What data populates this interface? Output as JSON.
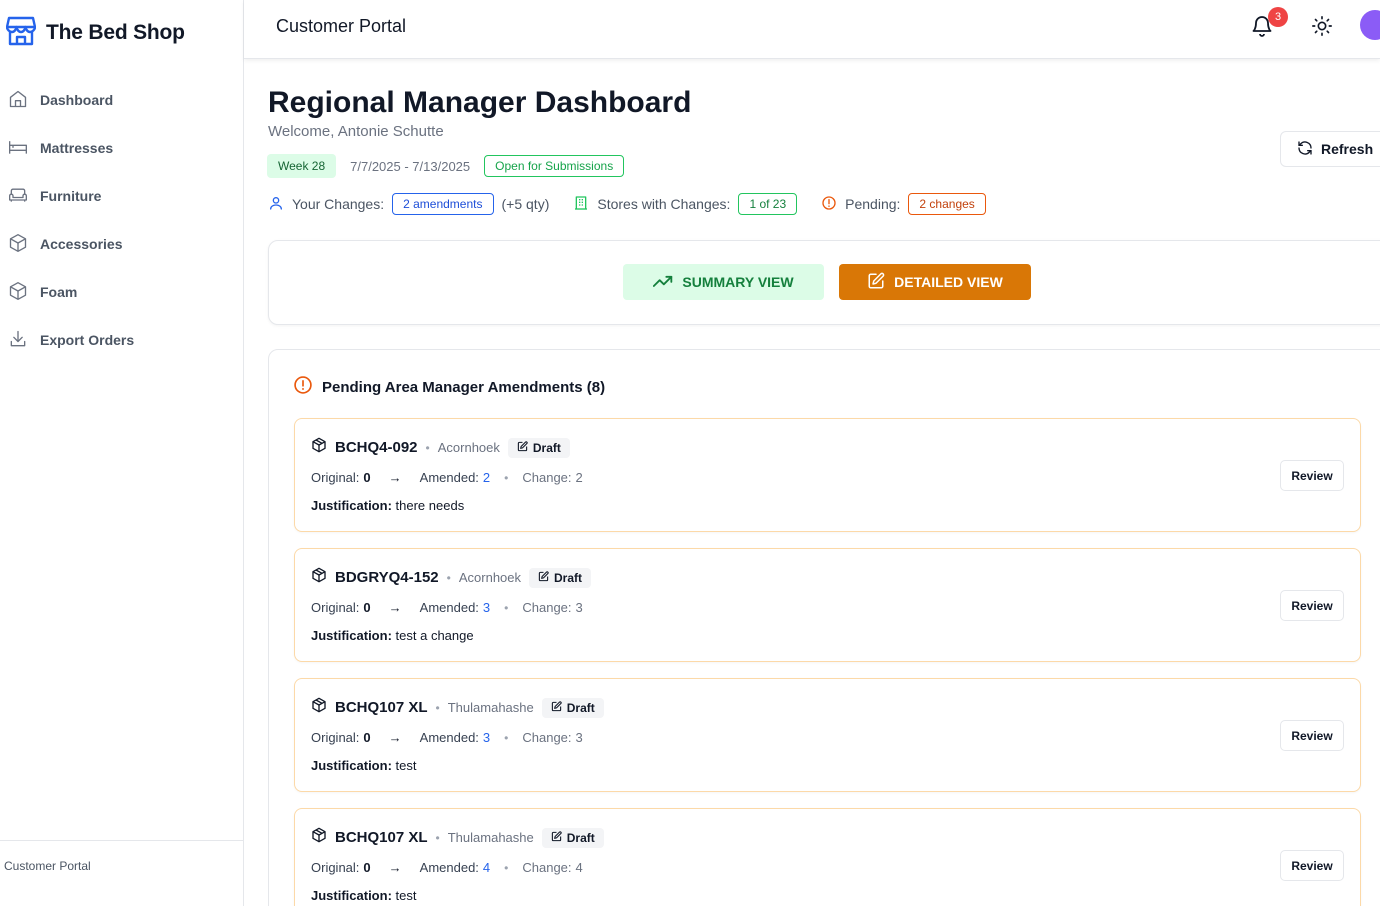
{
  "brand": {
    "name": "The Bed Shop"
  },
  "sidebar": {
    "items": [
      {
        "label": "Dashboard",
        "icon": "home-icon"
      },
      {
        "label": "Mattresses",
        "icon": "bed-icon"
      },
      {
        "label": "Furniture",
        "icon": "sofa-icon"
      },
      {
        "label": "Accessories",
        "icon": "box-icon"
      },
      {
        "label": "Foam",
        "icon": "box-icon"
      },
      {
        "label": "Export Orders",
        "icon": "download-icon"
      }
    ],
    "footer": "Customer Portal"
  },
  "topbar": {
    "title": "Customer Portal",
    "notification_count": "3"
  },
  "header": {
    "title": "Regional Manager Dashboard",
    "welcome": "Welcome, Antonie Schutte",
    "refresh_label": "Refresh"
  },
  "meta": {
    "week": "Week 28",
    "dates": "7/7/2025 - 7/13/2025",
    "status": "Open for Submissions"
  },
  "stats": {
    "changes_label": "Your Changes:",
    "changes_value": "2 amendments",
    "changes_qty": "(+5 qty)",
    "stores_label": "Stores with Changes:",
    "stores_value": "1 of 23",
    "pending_label": "Pending:",
    "pending_value": "2 changes"
  },
  "views": {
    "summary_label": "SUMMARY VIEW",
    "detailed_label": "DETAILED VIEW"
  },
  "pending": {
    "title": "Pending Area Manager Amendments (8)",
    "labels": {
      "original": "Original:",
      "amended": "Amended:",
      "change": "Change:",
      "justification": "Justification:",
      "review": "Review"
    },
    "items": [
      {
        "code": "BCHQ4-092",
        "store": "Acornhoek",
        "status": "Draft",
        "original": "0",
        "amended": "2",
        "change": "2",
        "justification": "there needs"
      },
      {
        "code": "BDGRYQ4-152",
        "store": "Acornhoek",
        "status": "Draft",
        "original": "0",
        "amended": "3",
        "change": "3",
        "justification": "test a change"
      },
      {
        "code": "BCHQ107 XL",
        "store": "Thulamahashe",
        "status": "Draft",
        "original": "0",
        "amended": "3",
        "change": "3",
        "justification": "test"
      },
      {
        "code": "BCHQ107 XL",
        "store": "Thulamahashe",
        "status": "Draft",
        "original": "0",
        "amended": "4",
        "change": "4",
        "justification": "test"
      }
    ]
  },
  "colors": {
    "accent": "#d97706",
    "success": "#16a34a",
    "link": "#2563eb",
    "warning": "#ea580c"
  }
}
